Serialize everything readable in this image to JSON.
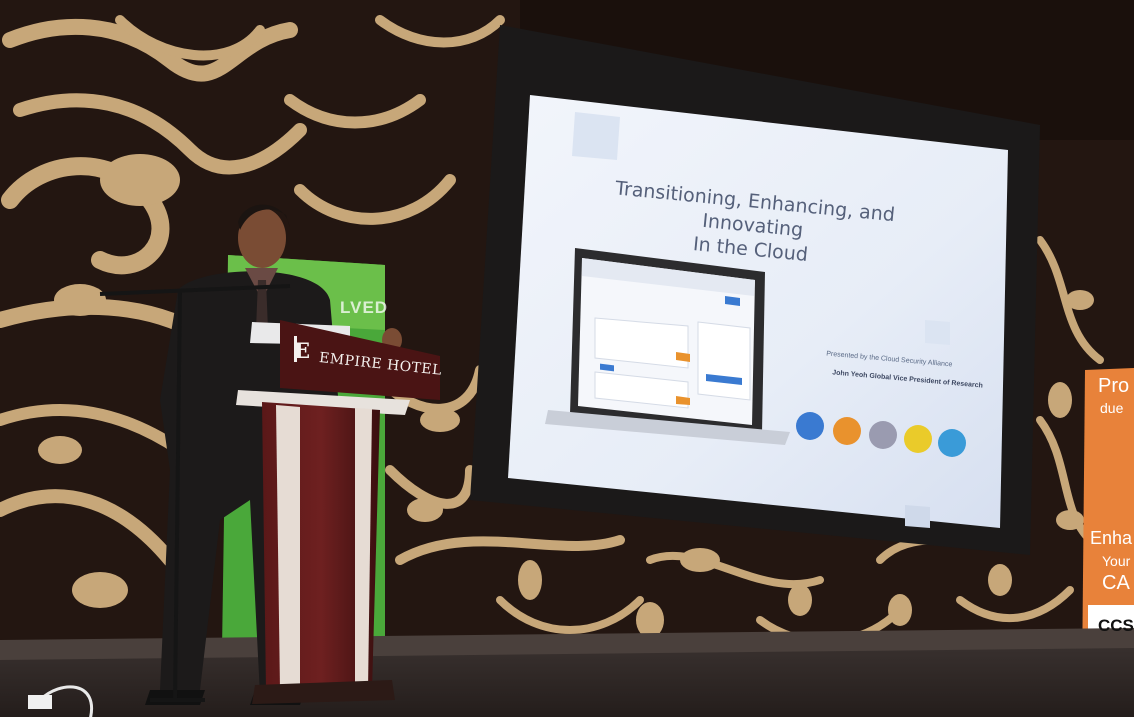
{
  "slide": {
    "title_line1": "Transitioning, Enhancing, and Innovating",
    "title_line2": "In the Cloud",
    "presented_by": "Presented by the Cloud Security Alliance",
    "presenter": "John Yeoh Global Vice President of Research"
  },
  "podium": {
    "logo_letter": "E",
    "hotel_name": "EMPIRE HOTEL"
  },
  "banners": {
    "left_text": "LVED",
    "right_line1": "Pro",
    "right_line2": "due",
    "right_line3": "Enha",
    "right_line4": "Your",
    "right_line5": "CA",
    "right_line6": "CCS"
  },
  "colors": {
    "wall": "#231611",
    "ornament": "#c7a779",
    "screen": "#e7eef8",
    "podium": "#4a1414",
    "banner_green": "#4aa83a",
    "banner_orange": "#e8823a",
    "circle_1": "#3a7ad1",
    "circle_2": "#e9922d",
    "circle_3": "#9a9bb0",
    "circle_4": "#eacb2a",
    "circle_5": "#3a9bd8"
  }
}
